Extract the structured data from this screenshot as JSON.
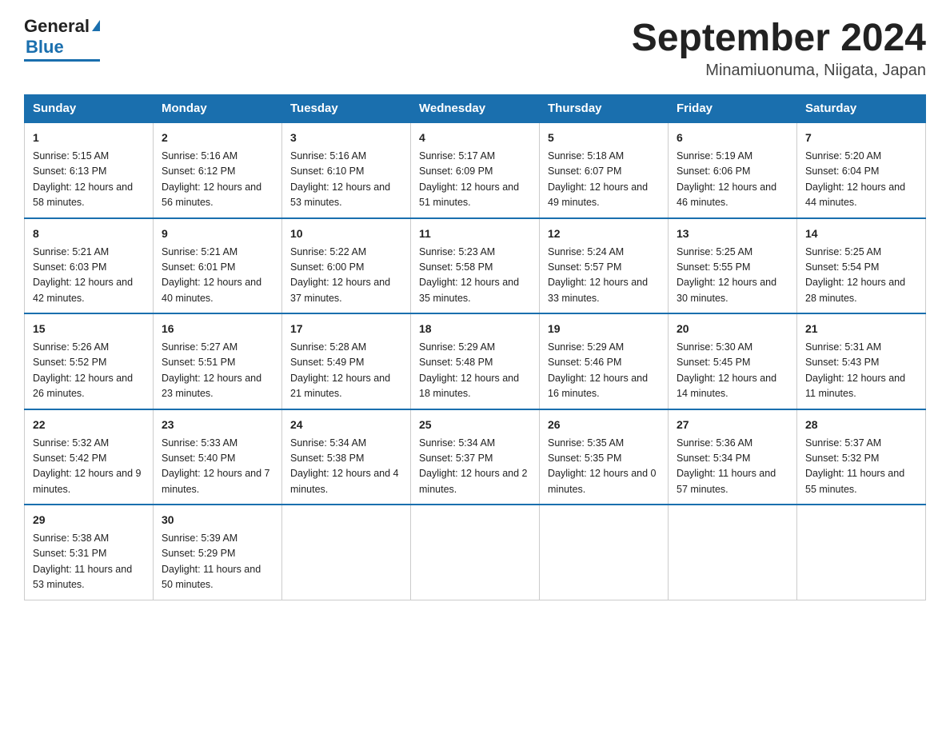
{
  "logo": {
    "general": "General",
    "blue": "Blue"
  },
  "title": "September 2024",
  "location": "Minamiuonuma, Niigata, Japan",
  "days_of_week": [
    "Sunday",
    "Monday",
    "Tuesday",
    "Wednesday",
    "Thursday",
    "Friday",
    "Saturday"
  ],
  "weeks": [
    [
      {
        "num": "1",
        "sunrise": "5:15 AM",
        "sunset": "6:13 PM",
        "daylight": "12 hours and 58 minutes."
      },
      {
        "num": "2",
        "sunrise": "5:16 AM",
        "sunset": "6:12 PM",
        "daylight": "12 hours and 56 minutes."
      },
      {
        "num": "3",
        "sunrise": "5:16 AM",
        "sunset": "6:10 PM",
        "daylight": "12 hours and 53 minutes."
      },
      {
        "num": "4",
        "sunrise": "5:17 AM",
        "sunset": "6:09 PM",
        "daylight": "12 hours and 51 minutes."
      },
      {
        "num": "5",
        "sunrise": "5:18 AM",
        "sunset": "6:07 PM",
        "daylight": "12 hours and 49 minutes."
      },
      {
        "num": "6",
        "sunrise": "5:19 AM",
        "sunset": "6:06 PM",
        "daylight": "12 hours and 46 minutes."
      },
      {
        "num": "7",
        "sunrise": "5:20 AM",
        "sunset": "6:04 PM",
        "daylight": "12 hours and 44 minutes."
      }
    ],
    [
      {
        "num": "8",
        "sunrise": "5:21 AM",
        "sunset": "6:03 PM",
        "daylight": "12 hours and 42 minutes."
      },
      {
        "num": "9",
        "sunrise": "5:21 AM",
        "sunset": "6:01 PM",
        "daylight": "12 hours and 40 minutes."
      },
      {
        "num": "10",
        "sunrise": "5:22 AM",
        "sunset": "6:00 PM",
        "daylight": "12 hours and 37 minutes."
      },
      {
        "num": "11",
        "sunrise": "5:23 AM",
        "sunset": "5:58 PM",
        "daylight": "12 hours and 35 minutes."
      },
      {
        "num": "12",
        "sunrise": "5:24 AM",
        "sunset": "5:57 PM",
        "daylight": "12 hours and 33 minutes."
      },
      {
        "num": "13",
        "sunrise": "5:25 AM",
        "sunset": "5:55 PM",
        "daylight": "12 hours and 30 minutes."
      },
      {
        "num": "14",
        "sunrise": "5:25 AM",
        "sunset": "5:54 PM",
        "daylight": "12 hours and 28 minutes."
      }
    ],
    [
      {
        "num": "15",
        "sunrise": "5:26 AM",
        "sunset": "5:52 PM",
        "daylight": "12 hours and 26 minutes."
      },
      {
        "num": "16",
        "sunrise": "5:27 AM",
        "sunset": "5:51 PM",
        "daylight": "12 hours and 23 minutes."
      },
      {
        "num": "17",
        "sunrise": "5:28 AM",
        "sunset": "5:49 PM",
        "daylight": "12 hours and 21 minutes."
      },
      {
        "num": "18",
        "sunrise": "5:29 AM",
        "sunset": "5:48 PM",
        "daylight": "12 hours and 18 minutes."
      },
      {
        "num": "19",
        "sunrise": "5:29 AM",
        "sunset": "5:46 PM",
        "daylight": "12 hours and 16 minutes."
      },
      {
        "num": "20",
        "sunrise": "5:30 AM",
        "sunset": "5:45 PM",
        "daylight": "12 hours and 14 minutes."
      },
      {
        "num": "21",
        "sunrise": "5:31 AM",
        "sunset": "5:43 PM",
        "daylight": "12 hours and 11 minutes."
      }
    ],
    [
      {
        "num": "22",
        "sunrise": "5:32 AM",
        "sunset": "5:42 PM",
        "daylight": "12 hours and 9 minutes."
      },
      {
        "num": "23",
        "sunrise": "5:33 AM",
        "sunset": "5:40 PM",
        "daylight": "12 hours and 7 minutes."
      },
      {
        "num": "24",
        "sunrise": "5:34 AM",
        "sunset": "5:38 PM",
        "daylight": "12 hours and 4 minutes."
      },
      {
        "num": "25",
        "sunrise": "5:34 AM",
        "sunset": "5:37 PM",
        "daylight": "12 hours and 2 minutes."
      },
      {
        "num": "26",
        "sunrise": "5:35 AM",
        "sunset": "5:35 PM",
        "daylight": "12 hours and 0 minutes."
      },
      {
        "num": "27",
        "sunrise": "5:36 AM",
        "sunset": "5:34 PM",
        "daylight": "11 hours and 57 minutes."
      },
      {
        "num": "28",
        "sunrise": "5:37 AM",
        "sunset": "5:32 PM",
        "daylight": "11 hours and 55 minutes."
      }
    ],
    [
      {
        "num": "29",
        "sunrise": "5:38 AM",
        "sunset": "5:31 PM",
        "daylight": "11 hours and 53 minutes."
      },
      {
        "num": "30",
        "sunrise": "5:39 AM",
        "sunset": "5:29 PM",
        "daylight": "11 hours and 50 minutes."
      },
      null,
      null,
      null,
      null,
      null
    ]
  ]
}
